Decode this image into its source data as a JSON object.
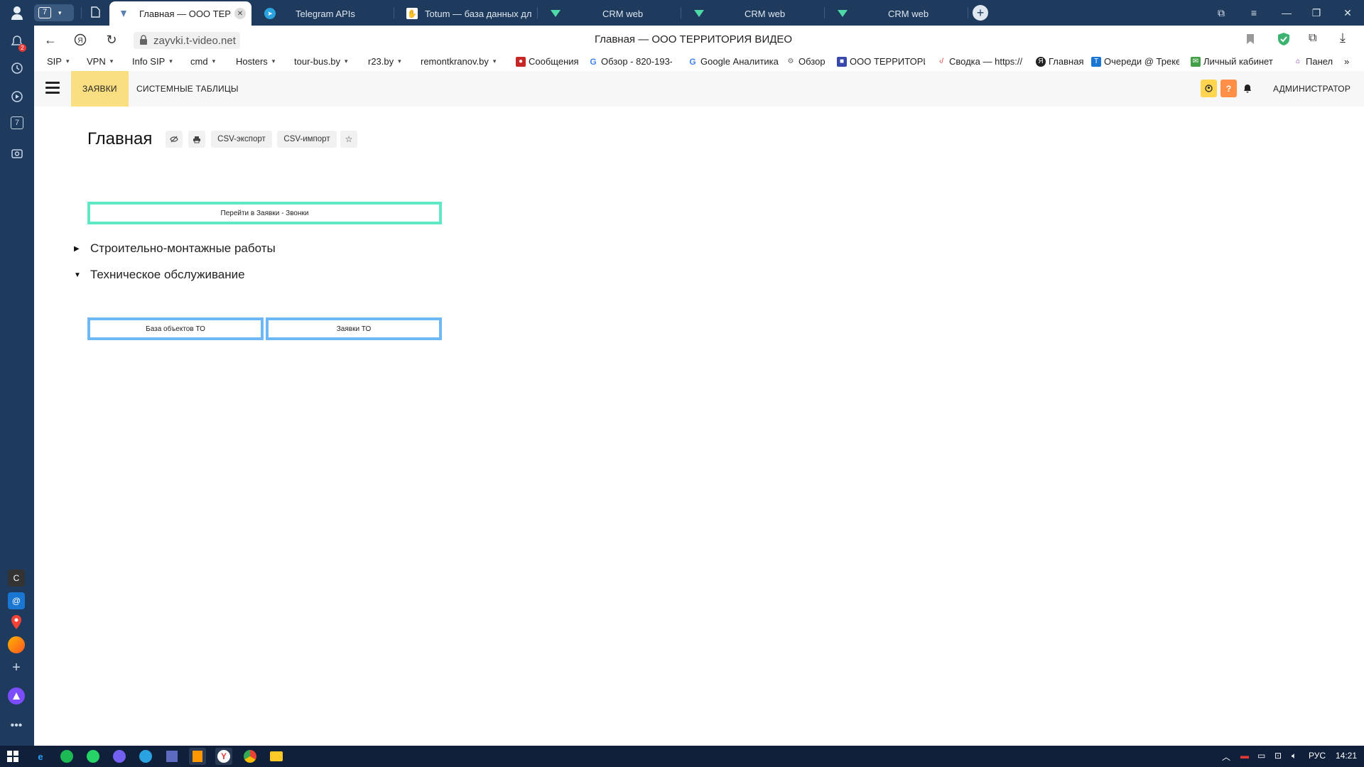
{
  "browser": {
    "tab_count": "7",
    "tabs": [
      {
        "title": "Главная — ООО ТЕРРИТ"
      },
      {
        "title": "Telegram APIs"
      },
      {
        "title": "Totum — база данных для"
      },
      {
        "title": "CRM web"
      },
      {
        "title": "CRM web"
      },
      {
        "title": "CRM web"
      }
    ],
    "url": "zayvki.t-video.net",
    "page_title": "Главная — ООО ТЕРРИТОРИЯ ВИДЕО",
    "notification_badge": "2",
    "sidebar_calendar_label": "7",
    "sidebar_c_label": "C",
    "bookmarks": [
      "SIP",
      "VPN",
      "Info SIP",
      "cmd",
      "Hosters",
      "tour-bus.by",
      "r23.by",
      "remontkranov.by",
      "Сообщения",
      "Обзор - 820-193-",
      "Google Аналитика",
      "Обзор",
      "ООО ТЕРРИТОРИ",
      "Сводка — https://",
      "Главная",
      "Очереди @ Треке",
      "Личный кабинет",
      "Панел"
    ]
  },
  "app": {
    "nav_tabs": [
      "ЗАЯВКИ",
      "СИСТЕМНЫЕ ТАБЛИЦЫ"
    ],
    "user_label": "АДМИНИСТРАТОР",
    "help_label": "?",
    "page_heading": "Главная",
    "toolbar": {
      "csv_export": "CSV-экспорт",
      "csv_import": "CSV-импорт"
    },
    "buttons": {
      "go_calls": "Перейти в Заявки - Звонки",
      "base_to": "База объектов ТО",
      "requests_to": "Заявки ТО"
    },
    "sections": [
      {
        "label": "Строительно-монтажные работы",
        "expanded": false
      },
      {
        "label": "Техническое обслуживание",
        "expanded": true
      }
    ],
    "colors": {
      "active_tab": "#fadf82",
      "button_green_border": "#5ee8c5",
      "button_blue_border": "#6db8f5",
      "help_orange": "#ff8f47",
      "user_yellow": "#ffd54f"
    }
  },
  "taskbar": {
    "lang": "РУС",
    "time": "14:21"
  }
}
